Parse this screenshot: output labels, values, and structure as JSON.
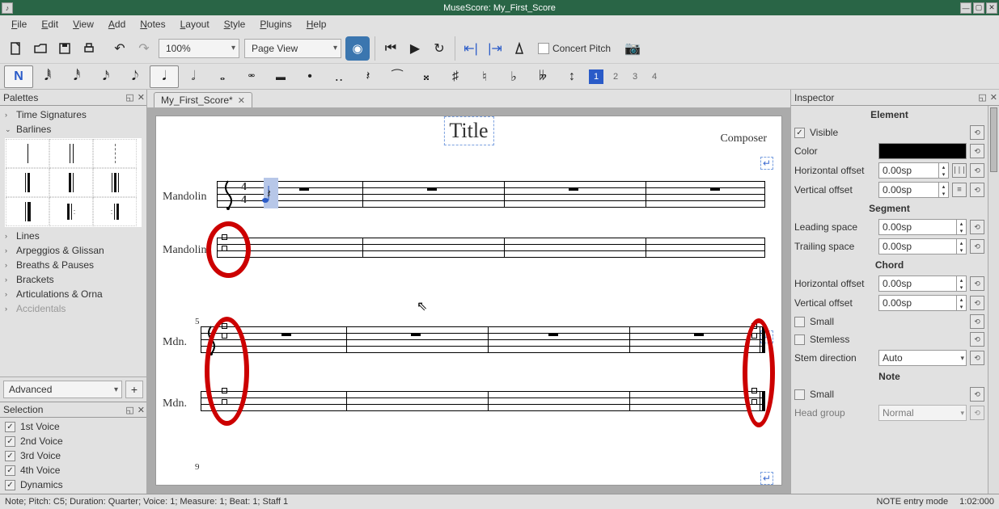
{
  "window_title": "MuseScore: My_First_Score",
  "menu": {
    "file": "File",
    "edit": "Edit",
    "view": "View",
    "add": "Add",
    "notes": "Notes",
    "layout": "Layout",
    "style": "Style",
    "plugins": "Plugins",
    "help": "Help"
  },
  "toolbar": {
    "zoom": "100%",
    "view_mode": "Page View",
    "concert_pitch": "Concert Pitch"
  },
  "voices": {
    "v1": "1",
    "v2": "2",
    "v3": "3",
    "v4": "4"
  },
  "palettes": {
    "title": "Palettes",
    "items": [
      "Time Signatures",
      "Barlines",
      "Lines",
      "Arpeggios & Glissan",
      "Breaths & Pauses",
      "Brackets",
      "Articulations & Orna",
      "Accidentals"
    ],
    "advanced": "Advanced"
  },
  "selection": {
    "title": "Selection",
    "items": [
      "1st Voice",
      "2nd Voice",
      "3rd Voice",
      "4th Voice",
      "Dynamics"
    ]
  },
  "document": {
    "tab": "My_First_Score*",
    "title": "Title",
    "composer": "Composer",
    "system1_label": "Mandolin",
    "system1_label2": "Mandolin",
    "system2_label": "Mdn.",
    "system2_label2": "Mdn.",
    "measure5": "5",
    "measure9": "9"
  },
  "inspector": {
    "title": "Inspector",
    "element": "Element",
    "segment": "Segment",
    "chord": "Chord",
    "note": "Note",
    "visible": "Visible",
    "color": "Color",
    "horizontal_offset": "Horizontal offset",
    "vertical_offset": "Vertical offset",
    "leading_space": "Leading space",
    "trailing_space": "Trailing space",
    "small": "Small",
    "stemless": "Stemless",
    "stem_direction": "Stem direction",
    "head_group": "Head group",
    "values": {
      "hoffset": "0.00sp",
      "voffset": "0.00sp",
      "leading": "0.00sp",
      "trailing": "0.00sp",
      "chord_hoffset": "0.00sp",
      "chord_voffset": "0.00sp",
      "stem_dir": "Auto",
      "head_group": "Normal"
    }
  },
  "statusbar": {
    "left": "Note; Pitch: C5; Duration: Quarter; Voice: 1;  Measure: 1; Beat: 1; Staff 1",
    "mode": "NOTE entry mode",
    "time": "1:02:000"
  }
}
